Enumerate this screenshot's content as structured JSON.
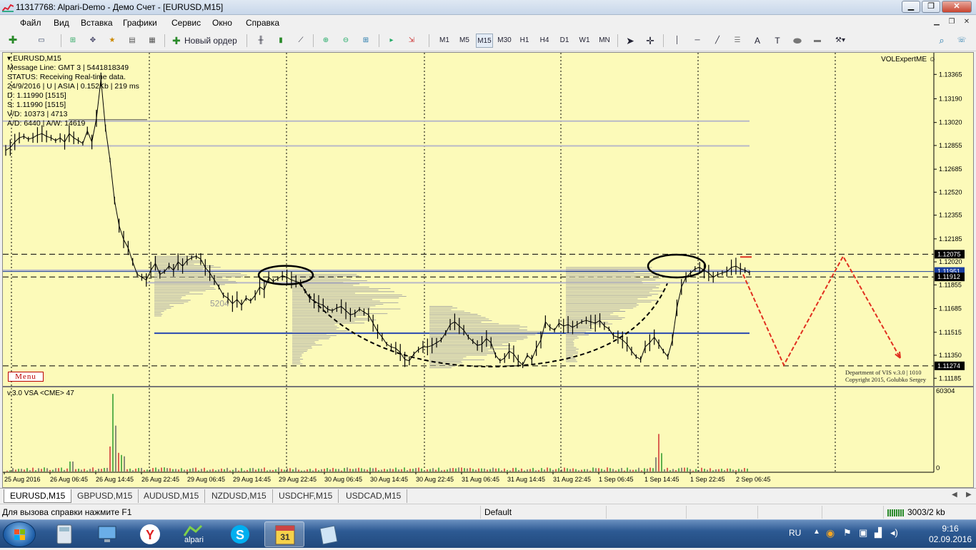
{
  "window": {
    "title": "11317768: Alpari-Demo - Демо Счет - [EURUSD,M15]"
  },
  "menu": [
    "Файл",
    "Вид",
    "Вставка",
    "Графики",
    "Сервис",
    "Окно",
    "Справка"
  ],
  "toolbar": {
    "new_order": "Новый ордер",
    "timeframes": [
      "M1",
      "M5",
      "M15",
      "M30",
      "H1",
      "H4",
      "D1",
      "W1",
      "MN"
    ],
    "selected_tf": "M15",
    "text_tool": "A",
    "text_label_tool": "T"
  },
  "chart": {
    "symbol_header": "EURUSD,M15",
    "info_lines": [
      "Message Line: GMT 3 | 5441818349",
      "STATUS:  Receiving Real-time data.",
      "24/9/2016 | U | ASIA | 0.152Kb | 219 ms",
      "D: 1.11990  [1515]",
      "S: 1.11990  [1515]",
      "V/D: 10373 | 4713",
      "A/D: 6440 | A/W: 14619"
    ],
    "indicator_name": "VOLExpertME",
    "profile_label": "5204",
    "menu_label": "Menu",
    "copyright": [
      "Department of VIS  v.3.0 | 1010",
      "Copyright 2015, Golubko Sergey"
    ],
    "sub_window_label": "v.3.0 VSA <CME> 47",
    "sub_window_max": "60304",
    "sub_window_min": "0"
  },
  "chart_data": {
    "type": "line",
    "title": "EURUSD,M15",
    "ylim": [
      1.1113,
      1.1352
    ],
    "price_ticks": [
      "1.13365",
      "1.13190",
      "1.13020",
      "1.12855",
      "1.12685",
      "1.12520",
      "1.12355",
      "1.12185",
      "1.12020",
      "1.11855",
      "1.11685",
      "1.11515",
      "1.11350",
      "1.11185"
    ],
    "highlighted_prices": [
      {
        "value": "1.12075",
        "color": "#000000"
      },
      {
        "value": "1.11951",
        "color": "#1a3fa0"
      },
      {
        "value": "1.11912",
        "color": "#000000"
      },
      {
        "value": "1.11274",
        "color": "#000000"
      }
    ],
    "time_ticks": [
      "25 Aug 2016",
      "26 Aug 06:45",
      "26 Aug 14:45",
      "26 Aug 22:45",
      "29 Aug 06:45",
      "29 Aug 14:45",
      "29 Aug 22:45",
      "30 Aug 06:45",
      "30 Aug 14:45",
      "30 Aug 22:45",
      "31 Aug 06:45",
      "31 Aug 14:45",
      "31 Aug 22:45",
      "1 Sep 06:45",
      "1 Sep 14:45",
      "1 Sep 22:45",
      "2 Sep 06:45"
    ],
    "series": [
      {
        "values": [
          1.1282,
          1.1284,
          1.1288,
          1.1291,
          1.1292,
          1.129,
          1.1291,
          1.1293,
          1.1294,
          1.1292,
          1.1291,
          1.1289,
          1.1291,
          1.1288,
          1.1294,
          1.1291,
          1.1289,
          1.1287,
          1.1296,
          1.1288,
          1.1305,
          1.1333,
          1.1298,
          1.1275,
          1.1246,
          1.1228,
          1.1218,
          1.1212,
          1.1202,
          1.1193,
          1.1191,
          1.1189,
          1.1196,
          1.1201,
          1.1193,
          1.1195,
          1.1199,
          1.1196,
          1.1202,
          1.1199,
          1.1203,
          1.1205,
          1.1206,
          1.1204,
          1.1198,
          1.1194,
          1.1189,
          1.1184,
          1.1178,
          1.1176,
          1.1172,
          1.1175,
          1.1171,
          1.1176,
          1.1174,
          1.1178,
          1.1184,
          1.1182,
          1.1191,
          1.1188,
          1.119,
          1.1192,
          1.1191,
          1.1189,
          1.1188,
          1.1187,
          1.1181,
          1.1176,
          1.1174,
          1.1172,
          1.1171,
          1.1168,
          1.1167,
          1.1169,
          1.117,
          1.1167,
          1.1164,
          1.1165,
          1.1168,
          1.1166,
          1.1164,
          1.1158,
          1.1152,
          1.1148,
          1.1143,
          1.1141,
          1.114,
          1.1137,
          1.1132,
          1.1131,
          1.1136,
          1.1139,
          1.1141,
          1.1141,
          1.1142,
          1.1144,
          1.1146,
          1.1151,
          1.1157,
          1.1159,
          1.1156,
          1.1153,
          1.1148,
          1.1145,
          1.1142,
          1.1143,
          1.1147,
          1.1144,
          1.1135,
          1.1131,
          1.1133,
          1.1138,
          1.1136,
          1.1131,
          1.1128,
          1.1135,
          1.1132,
          1.114,
          1.1146,
          1.1159,
          1.1155,
          1.1153,
          1.1158,
          1.1156,
          1.1157,
          1.1155,
          1.1157,
          1.1159,
          1.116,
          1.1159,
          1.1158,
          1.116,
          1.1156,
          1.1154,
          1.1149,
          1.1148,
          1.1146,
          1.1143,
          1.1138,
          1.1134,
          1.1132,
          1.1141,
          1.1144,
          1.1148,
          1.1143,
          1.1138,
          1.1134,
          1.1146,
          1.1169,
          1.1184,
          1.1191,
          1.1194,
          1.1197,
          1.1198,
          1.1196,
          1.1194,
          1.1191,
          1.1193,
          1.1194,
          1.1195,
          1.1198,
          1.1199,
          1.1197,
          1.1196,
          1.1194
        ]
      },
      {
        "name": "forecast",
        "values": [
          1.1193,
          1.1128,
          1.1206,
          1.1133
        ]
      }
    ],
    "grid": false
  },
  "tabs": [
    "EURUSD,M15",
    "GBPUSD,M15",
    "AUDUSD,M15",
    "NZDUSD,M15",
    "USDCHF,M15",
    "USDCAD,M15"
  ],
  "active_tab": "EURUSD,M15",
  "status": {
    "help": "Для вызова справки нажмите F1",
    "profile": "Default",
    "traffic": "3003/2 kb"
  },
  "taskbar": {
    "apps": [
      "ie-explorer",
      "computer",
      "yandex",
      "alpari",
      "skype",
      "calendar",
      "notes"
    ],
    "active_app": "calendar",
    "lang": "RU",
    "time": "9:16",
    "date": "02.09.2016",
    "alpari_label": "alpari",
    "calendar_day": "31"
  },
  "colors": {
    "chart_bg": "#fcfab9",
    "candles": "#000000",
    "profile": "#a0a0a0",
    "forecast": "#e03020",
    "ellipse": "#000000",
    "level_blue": "#2848b0"
  }
}
